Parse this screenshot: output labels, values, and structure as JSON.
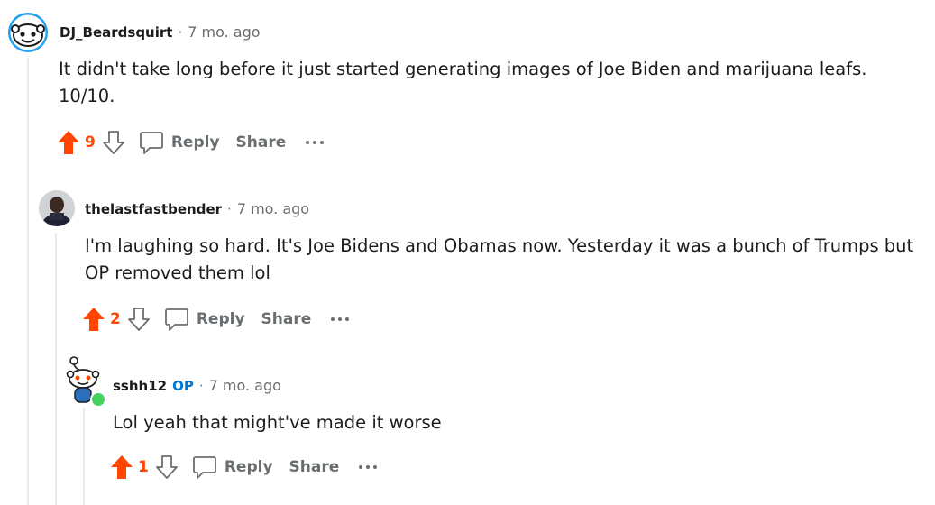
{
  "comments": [
    {
      "author": "DJ_Beardsquirt",
      "separator": "·",
      "time": "7 mo. ago",
      "body_line1": "It didn't take long before it just started generating images of Joe Biden and marijuana leafs.",
      "body_line2": "10/10.",
      "score": "9",
      "reply": "Reply",
      "share": "Share"
    },
    {
      "author": "thelastfastbender",
      "separator": "·",
      "time": "7 mo. ago",
      "body_line1": "I'm laughing so hard. It's Joe Bidens and Obamas now. Yesterday it was a bunch of Trumps but",
      "body_line2": "OP removed them lol",
      "score": "2",
      "reply": "Reply",
      "share": "Share"
    },
    {
      "author": "sshh12",
      "op_badge": "OP",
      "separator": "·",
      "time": "7 mo. ago",
      "body_line1": "Lol yeah that might've made it worse",
      "score": "1",
      "reply": "Reply",
      "share": "Share"
    }
  ],
  "colors": {
    "upvote": "#ff4500",
    "op": "#0079d3",
    "muted": "#6a6e70",
    "thread_line": "#e5ebee",
    "online": "#46d160"
  },
  "icons": [
    "reddit-snoo-avatar-icon",
    "upvote-arrow-icon",
    "downvote-arrow-icon",
    "comment-bubble-icon",
    "more-options-icon",
    "online-status-icon"
  ]
}
